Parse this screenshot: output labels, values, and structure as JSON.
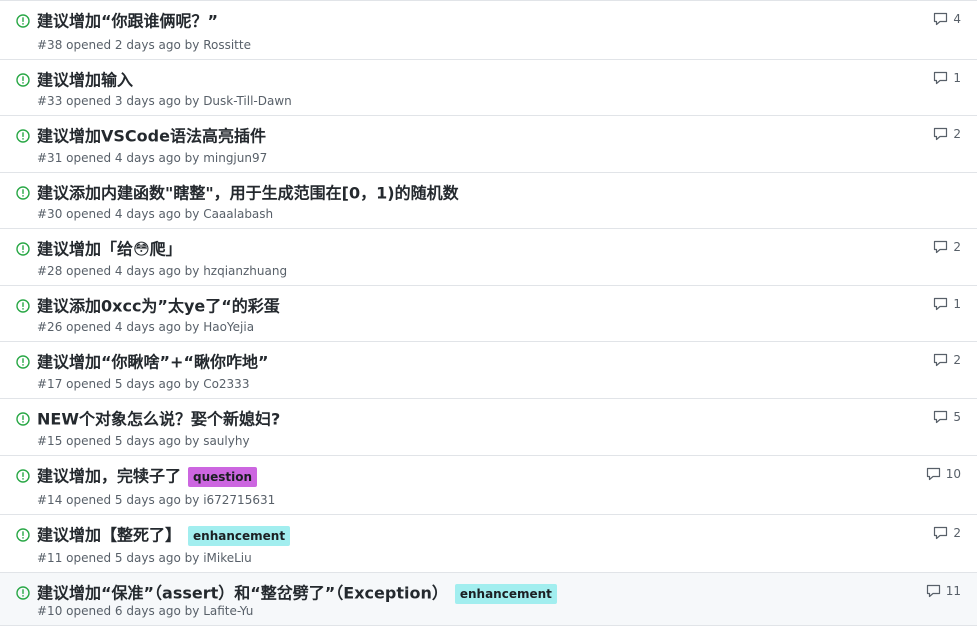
{
  "colors": {
    "open_icon": "#28a745",
    "label_question_bg": "#cc66e0",
    "label_question_fg": "#1b1f23",
    "label_enhancement_bg": "#a2eeef",
    "label_enhancement_fg": "#1b1f23"
  },
  "icons": {
    "issue": "issue-opened-icon",
    "comment": "comment-icon"
  },
  "issues": [
    {
      "title": "建议增加“你跟谁俩呢？”",
      "number": "#38",
      "opened": "opened 2 days ago by",
      "author": "Rossitte",
      "label": "",
      "comments": "4"
    },
    {
      "title": "建议增加输入",
      "number": "#33",
      "opened": "opened 3 days ago by",
      "author": "Dusk-Till-Dawn",
      "label": "",
      "comments": "1"
    },
    {
      "title": "建议增加VSCode语法高亮插件",
      "number": "#31",
      "opened": "opened 4 days ago by",
      "author": "mingjun97",
      "label": "",
      "comments": "2"
    },
    {
      "title": "建议添加内建函数\"瞎整\"，用于生成范围在[0，1)的随机数",
      "number": "#30",
      "opened": "opened 4 days ago by",
      "author": "Caaalabash",
      "label": "",
      "comments": ""
    },
    {
      "title": "建议增加「给😳爬」",
      "number": "#28",
      "opened": "opened 4 days ago by",
      "author": "hzqianzhuang",
      "label": "",
      "comments": "2"
    },
    {
      "title": "建议添加0xcc为”太ye了“的彩蛋",
      "number": "#26",
      "opened": "opened 4 days ago by",
      "author": "HaoYejia",
      "label": "",
      "comments": "1"
    },
    {
      "title": "建议增加“你瞅啥”+“瞅你咋地”",
      "number": "#17",
      "opened": "opened 5 days ago by",
      "author": "Co2333",
      "label": "",
      "comments": "2"
    },
    {
      "title": "NEW个对象怎么说？娶个新媳妇?",
      "number": "#15",
      "opened": "opened 5 days ago by",
      "author": "saulyhy",
      "label": "",
      "comments": "5"
    },
    {
      "title": "建议增加，完犊子了",
      "number": "#14",
      "opened": "opened 5 days ago by",
      "author": "i672715631",
      "label": "question",
      "comments": "10"
    },
    {
      "title": "建议增加【整死了】",
      "number": "#11",
      "opened": "opened 5 days ago by",
      "author": "iMikeLiu",
      "label": "enhancement",
      "comments": "2"
    },
    {
      "title": "建议增加“保准”（assert）和“整岔劈了”（Exception）",
      "number": "#10",
      "opened": "opened 6 days ago by",
      "author": "Lafite-Yu",
      "label": "enhancement",
      "comments": "11"
    }
  ]
}
